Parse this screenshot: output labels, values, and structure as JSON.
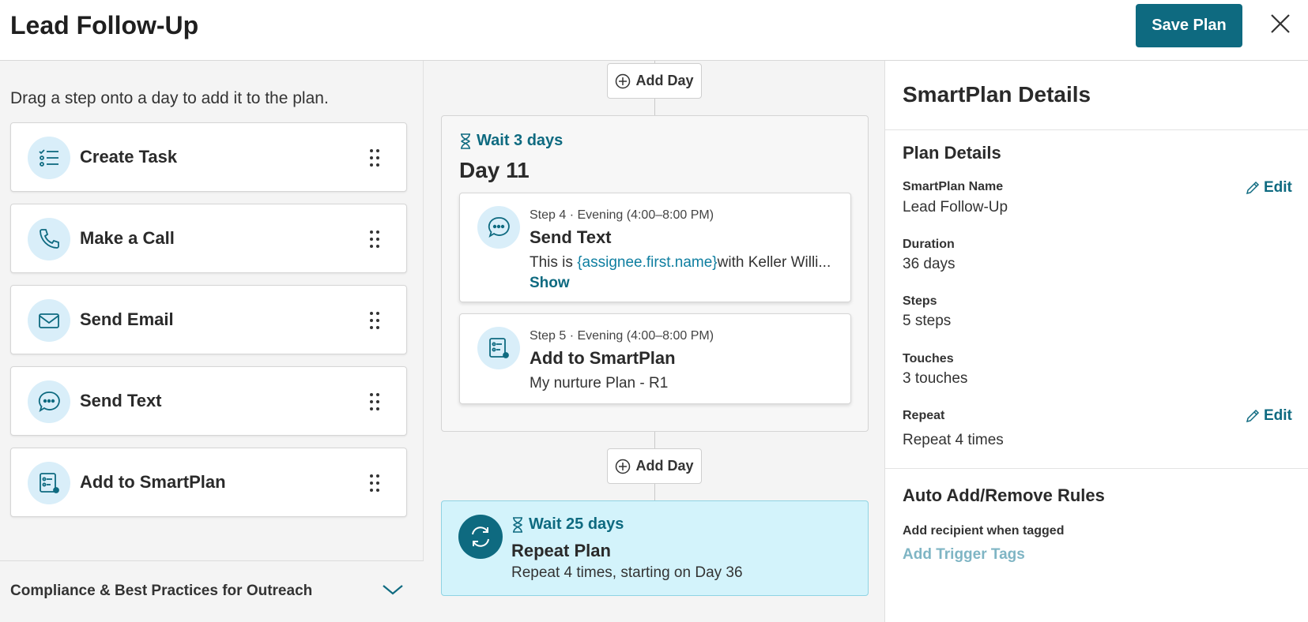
{
  "header": {
    "title": "Lead Follow-Up",
    "save_label": "Save Plan"
  },
  "left": {
    "hint": "Drag a step onto a day to add it to the plan.",
    "steps": [
      {
        "label": "Create Task",
        "icon": "task-list-icon"
      },
      {
        "label": "Make a Call",
        "icon": "phone-icon"
      },
      {
        "label": "Send Email",
        "icon": "envelope-icon"
      },
      {
        "label": "Send Text",
        "icon": "chat-bubble-icon"
      },
      {
        "label": "Add to SmartPlan",
        "icon": "smartplan-icon"
      }
    ],
    "compliance_label": "Compliance & Best Practices for Outreach"
  },
  "timeline": {
    "add_day_label": "Add Day",
    "day": {
      "wait": "Wait 3 days",
      "title": "Day 11",
      "cards": [
        {
          "meta": "Step 4 · Evening (4:00–8:00 PM)",
          "title": "Send Text",
          "body_prefix": "This is ",
          "body_merge": "{assignee.first.name}",
          "body_suffix": "with Keller Willi...",
          "show_label": "Show"
        },
        {
          "meta": "Step 5 · Evening (4:00–8:00 PM)",
          "title": "Add to SmartPlan",
          "body": "My nurture Plan - R1"
        }
      ]
    },
    "repeat": {
      "wait": "Wait 25 days",
      "title": "Repeat Plan",
      "subtitle": "Repeat 4 times, starting on Day 36"
    }
  },
  "details": {
    "title": "SmartPlan Details",
    "plan_section": "Plan Details",
    "edit_label": "Edit",
    "fields": {
      "name_label": "SmartPlan Name",
      "name_value": "Lead Follow-Up",
      "duration_label": "Duration",
      "duration_value": "36 days",
      "steps_label": "Steps",
      "steps_value": "5 steps",
      "touches_label": "Touches",
      "touches_value": "3 touches",
      "repeat_label": "Repeat",
      "repeat_value": "Repeat 4 times"
    },
    "rules_section": "Auto Add/Remove Rules",
    "recipient_label": "Add recipient when tagged",
    "trigger_link": "Add Trigger Tags"
  },
  "colors": {
    "accent": "#0e6a80",
    "icon_bg": "#d9eef9",
    "repeat_bg": "#d3f3fb"
  }
}
